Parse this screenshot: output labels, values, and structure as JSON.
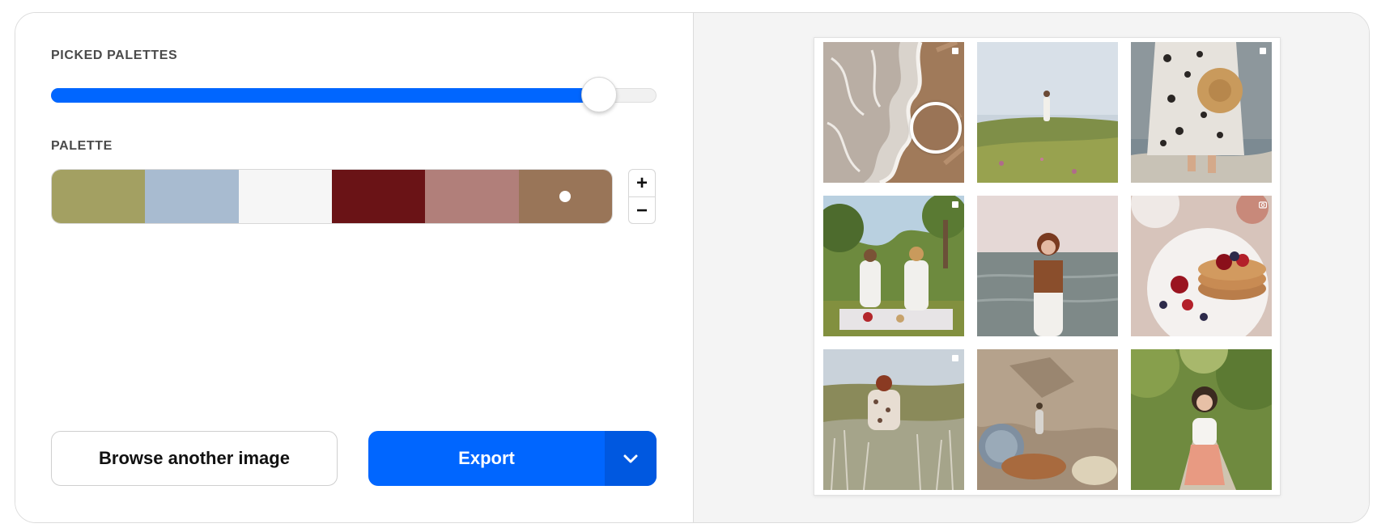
{
  "picked_palettes": {
    "label": "PICKED PALETTES",
    "value_fraction": 0.905
  },
  "palette": {
    "label": "PALETTE",
    "swatches": [
      "#a3a062",
      "#a8bbd0",
      "#f6f6f6",
      "#6a1316",
      "#b17f7a",
      "#997558"
    ],
    "selected_index": 5,
    "add_label": "+",
    "remove_label": "−"
  },
  "actions": {
    "browse_label": "Browse another image",
    "export_label": "Export"
  },
  "gallery": {
    "picker_color": "#9a7456",
    "tiles": [
      {
        "name": "beach-waves-photo",
        "badge": "square"
      },
      {
        "name": "woman-in-meadow-photo",
        "badge": ""
      },
      {
        "name": "woman-with-straw-hat-photo",
        "badge": "square"
      },
      {
        "name": "picnic-friends-photo",
        "badge": "square"
      },
      {
        "name": "woman-by-sea-photo",
        "badge": ""
      },
      {
        "name": "pancakes-with-berries-photo",
        "badge": "camera"
      },
      {
        "name": "woman-in-grass-field-photo",
        "badge": "square"
      },
      {
        "name": "rocky-cliff-photo",
        "badge": ""
      },
      {
        "name": "woman-on-forest-path-photo",
        "badge": ""
      }
    ]
  },
  "colors": {
    "accent": "#0066ff",
    "accent_dark": "#0058e0"
  }
}
